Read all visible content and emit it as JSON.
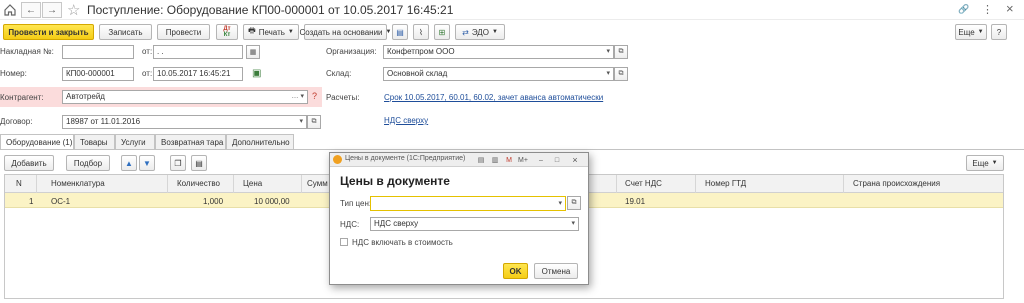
{
  "window": {
    "title": "Поступление: Оборудование КП00-000001 от 10.05.2017 16:45:21",
    "nav_back": "←",
    "nav_forward": "→",
    "link_icon": "🔗",
    "more_menu": "⋮",
    "close": "×"
  },
  "toolbar": {
    "post_close": "Провести и закрыть",
    "save": "Записать",
    "post": "Провести",
    "print": "Печать",
    "create_based": "Создать на основании",
    "edo": "ЭДО",
    "more": "Еще"
  },
  "form": {
    "invoice_label": "Накладная №:",
    "invoice_value": "",
    "invoice_from_label": "от:",
    "invoice_date": ". .",
    "number_label": "Номер:",
    "number_value": "КП00-000001",
    "date_from_label": "от:",
    "date_value": "10.05.2017 16:45:21",
    "counterparty_label": "Контрагент:",
    "counterparty_value": "Автотрейд",
    "contract_label": "Договор:",
    "contract_value": "18987 от 11.01.2016",
    "org_label": "Организация:",
    "org_value": "Конфетпром ООО",
    "warehouse_label": "Склад:",
    "warehouse_value": "Основной склад",
    "settlements_label": "Расчеты:",
    "settlements_link": "Срок 10.05.2017, 60.01, 60.02, зачет аванса автоматически",
    "vat_link": "НДС сверху",
    "question": "?"
  },
  "tabs": [
    {
      "label": "Оборудование (1)"
    },
    {
      "label": "Товары"
    },
    {
      "label": "Услуги"
    },
    {
      "label": "Возвратная тара"
    },
    {
      "label": "Дополнительно"
    }
  ],
  "grid_toolbar": {
    "add": "Добавить",
    "select": "Подбор",
    "more": "Еще"
  },
  "grid": {
    "columns": [
      "N",
      "Номенклатура",
      "Количество",
      "Цена",
      "Сумм",
      "",
      "Счет НДС",
      "Номер ГТД",
      "Страна происхождения"
    ],
    "rows": [
      {
        "n": "1",
        "item": "ОС-1",
        "qty": "1,000",
        "price": "10 000,00",
        "vat_account": "19.01"
      }
    ]
  },
  "dialog": {
    "titlebar": "Цены в документе (1С:Предприятие)",
    "heading": "Цены в документе",
    "price_type_label": "Тип цен:",
    "price_type_value": "",
    "vat_label": "НДС:",
    "vat_value": "НДС сверху",
    "vat_incl_label": "НДС включать в стоимость",
    "ok": "OK",
    "cancel": "Отмена"
  },
  "colors": {
    "primary_button": "#f5cd15",
    "highlight_row": "#fbf3c5",
    "required_field": "#fbdcdc",
    "link": "#1f4e9a"
  }
}
